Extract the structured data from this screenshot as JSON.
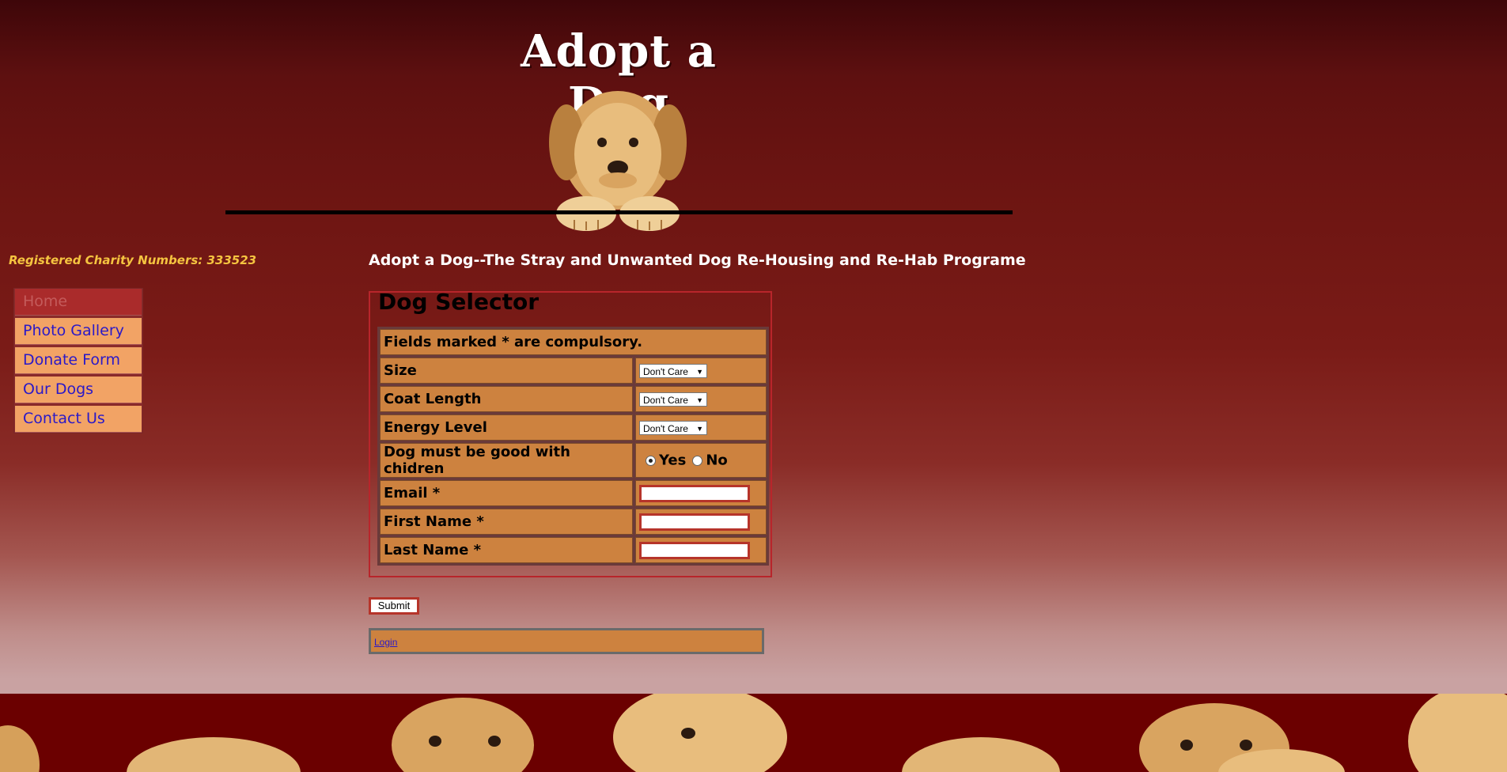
{
  "header": {
    "title": "Adopt a Dog"
  },
  "sidebar": {
    "charity": "Registered Charity Numbers: 333523",
    "nav": [
      {
        "label": "Home"
      },
      {
        "label": "Photo Gallery"
      },
      {
        "label": "Donate Form"
      },
      {
        "label": "Our Dogs"
      },
      {
        "label": "Contact Us"
      }
    ]
  },
  "main": {
    "tagline": "Adopt a Dog--The Stray and Unwanted Dog Re-Housing and Re-Hab Programe",
    "form": {
      "legend": "Dog Selector",
      "note": "Fields marked * are compulsory.",
      "size_label": "Size",
      "size_value": "Don't Care",
      "coat_label": "Coat Length",
      "coat_value": "Don't Care",
      "energy_label": "Energy Level",
      "energy_value": "Don't Care",
      "children_label": "Dog must be good with chidren",
      "children_yes": "Yes",
      "children_no": "No",
      "email_label": "Email *",
      "first_name_label": "First Name *",
      "last_name_label": "Last Name *",
      "submit": "Submit"
    },
    "login": "Login"
  },
  "colors": {
    "cell_bg": "#cd823f",
    "nav_bg": "#f2a365",
    "link": "#2a19c8",
    "charity_text": "#f5c440",
    "footer_bg": "#6b0000"
  }
}
